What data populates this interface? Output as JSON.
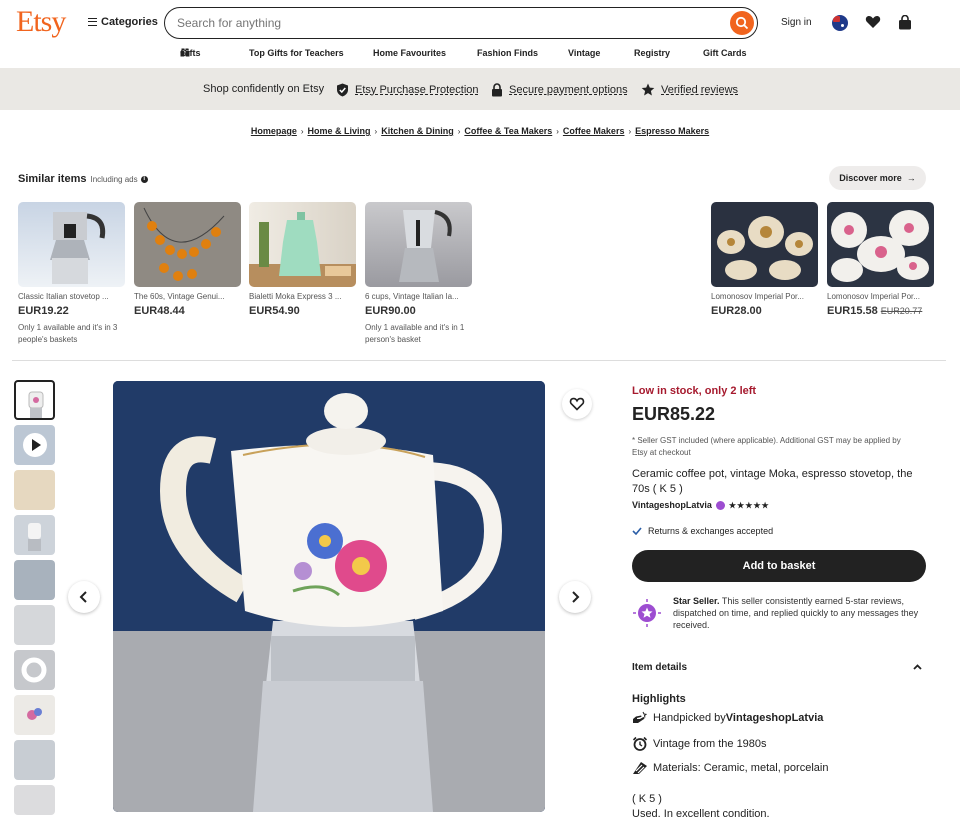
{
  "header": {
    "logo": "Etsy",
    "categories": "Categories",
    "search_placeholder": "Search for anything",
    "sign_in": "Sign in"
  },
  "nav": [
    "Gifts",
    "Top Gifts for Teachers",
    "Home Favourites",
    "Fashion Finds",
    "Vintage",
    "Registry",
    "Gift Cards"
  ],
  "trust": {
    "lead": "Shop confidently on Etsy",
    "items": [
      "Etsy Purchase Protection",
      "Secure payment options",
      "Verified reviews"
    ]
  },
  "breadcrumbs": [
    "Homepage",
    "Home & Living",
    "Kitchen & Dining",
    "Coffee & Tea Makers",
    "Coffee Makers",
    "Espresso Makers"
  ],
  "similar": {
    "title": "Similar items",
    "ads": "Including ads",
    "discover": "Discover more",
    "items": [
      {
        "title": "Classic Italian stovetop ...",
        "price": "EUR19.22",
        "note": "Only 1 available and it's in 3 people's baskets"
      },
      {
        "title": "The 60s, Vintage Genui...",
        "price": "EUR48.44",
        "note": ""
      },
      {
        "title": "Bialetti Moka Express 3 ...",
        "price": "EUR54.90",
        "note": ""
      },
      {
        "title": "6 cups, Vintage Italian la...",
        "price": "EUR90.00",
        "note": "Only 1 available and it's in 1 person's basket"
      },
      {
        "title": "Lomonosov Imperial Por...",
        "price": "EUR28.00",
        "note": ""
      },
      {
        "title": "Lomonosov Imperial Por...",
        "price": "EUR15.58",
        "old_price": "EUR20.77",
        "note": ""
      }
    ]
  },
  "product": {
    "stock": "Low in stock, only 2 left",
    "price": "EUR85.22",
    "gst": "* Seller GST included (where applicable). Additional GST may be applied by Etsy at checkout",
    "title": "Ceramic coffee pot, vintage Moka, espresso stovetop, the 70s ( K 5 )",
    "seller": "VintageshopLatvia",
    "stars": "★★★★★",
    "returns": "Returns & exchanges accepted",
    "basket": "Add to basket",
    "star_seller_bold": "Star Seller.",
    "star_seller_text": " This seller consistently earned 5-star reviews, dispatched on time, and replied quickly to any messages they received.",
    "item_details": "Item details",
    "highlights": "Highlights",
    "handpicked_prefix": "Handpicked by ",
    "handpicked_name": "VintageshopLatvia",
    "vintage": "Vintage from the 1980s",
    "materials": "Materials: Ceramic, metal, porcelain",
    "code": "( K 5 )",
    "condition": "Used. In excellent condition."
  },
  "colors": {
    "brand": "#f1641e",
    "stock": "#a61a2e",
    "dark": "#222222"
  }
}
